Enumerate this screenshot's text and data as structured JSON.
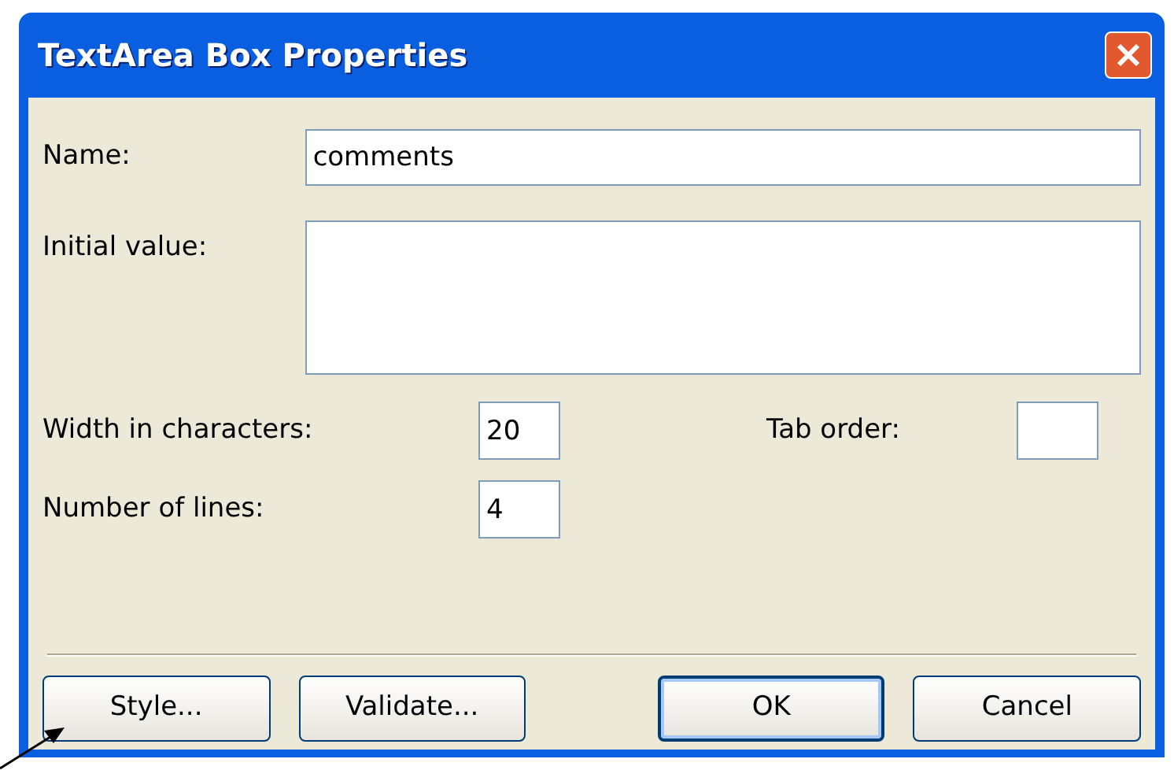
{
  "window": {
    "title": "TextArea Box Properties"
  },
  "fields": {
    "name": {
      "label": "Name:",
      "value": "comments"
    },
    "initial_value": {
      "label": "Initial value:"
    },
    "width": {
      "label": "Width in characters:",
      "value": "20"
    },
    "tab_order": {
      "label": "Tab order:"
    },
    "lines": {
      "label": "Number of lines:",
      "value": "4"
    }
  },
  "buttons": [
    {
      "label": "Style...",
      "default": false
    },
    {
      "label": "Validate...",
      "default": false
    },
    {
      "label": "OK",
      "default": true
    },
    {
      "label": "Cancel",
      "default": false
    }
  ]
}
